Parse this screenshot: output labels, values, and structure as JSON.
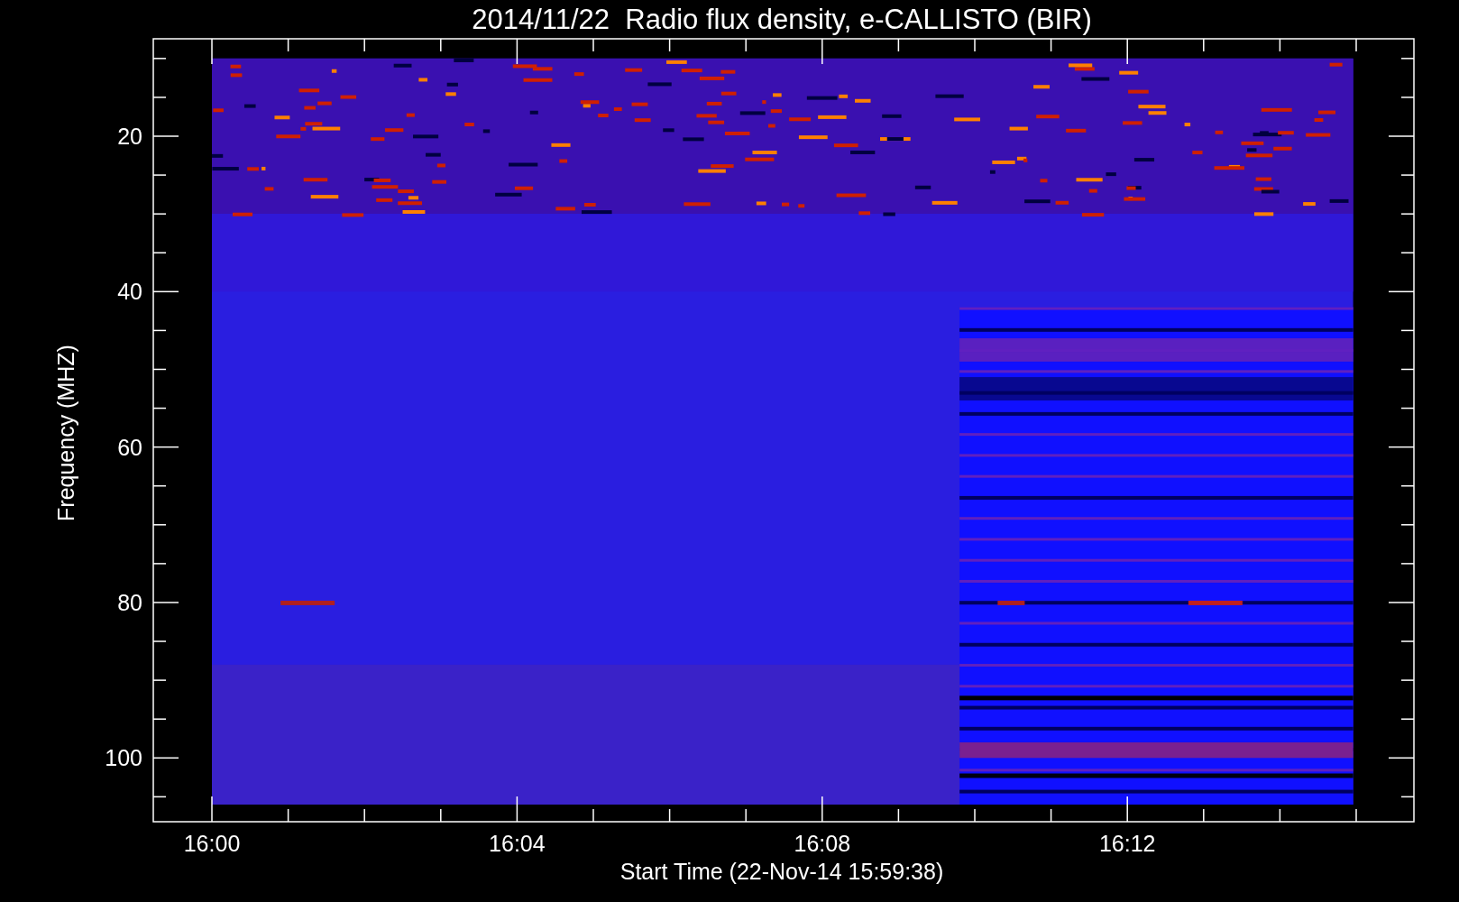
{
  "title": "2014/11/22  Radio flux density, e-CALLISTO (BIR)",
  "ylabel": "Frequency (MHZ)",
  "xlabel": "Start Time (22-Nov-14 15:59:38)",
  "yticks": [
    "20",
    "40",
    "60",
    "80",
    "100"
  ],
  "xticks": [
    "16:00",
    "16:04",
    "16:08",
    "16:12"
  ]
}
